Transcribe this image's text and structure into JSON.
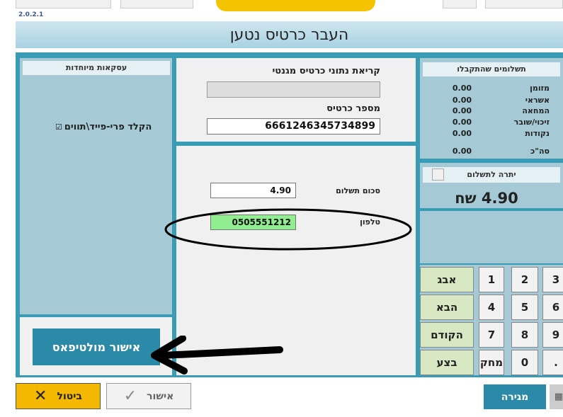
{
  "version": "2.0.2.1",
  "title": "העבר כרטיס נטען",
  "special": {
    "header": "עסקאות מיוחדות",
    "checkbox_label": "הקלד פרי-פייד\\תווים",
    "confirm_multipass": "אישור מולטיפאס"
  },
  "card": {
    "read_label": "קריאת נתוני כרטיס מגנטי",
    "number_label": "מספר כרטיס",
    "number_value": "6661246345734899"
  },
  "payment": {
    "amount_label": "סכום תשלום",
    "amount_value": "4.90",
    "phone_label": "טלפון",
    "phone_value": "0505551212"
  },
  "received": {
    "header": "תשלומים שהתקבלו",
    "rows": [
      {
        "label": "מזומן",
        "value": "0.00"
      },
      {
        "label": "אשראי",
        "value": "0.00"
      },
      {
        "label": "המחאה",
        "value": "0.00"
      },
      {
        "label": "זיכוי/שובר",
        "value": "0.00"
      },
      {
        "label": "נקודות",
        "value": "0.00"
      }
    ],
    "total_label": "סה\"כ",
    "total_value": "0.00"
  },
  "balance": {
    "header": "יתרה לתשלום",
    "value": "4.90 שח"
  },
  "keypad": {
    "abc": "אבג",
    "next": "הבא",
    "prev": "הקודם",
    "exec": "בצע",
    "delete": "מחק",
    "k1": "1",
    "k2": "2",
    "k3": "3",
    "k4": "4",
    "k5": "5",
    "k6": "6",
    "k7": "7",
    "k8": "8",
    "k9": "9",
    "k0": "0",
    "dot": "."
  },
  "bottom": {
    "cancel": "ביטול",
    "confirm": "אישור",
    "drawer": "מגירה"
  },
  "colors": {
    "frame": "#3a9bb5",
    "panel": "#a5cad6",
    "accent_yellow": "#f5b800",
    "phone_bg": "#90ee90",
    "button_teal": "#2a8aa8"
  }
}
